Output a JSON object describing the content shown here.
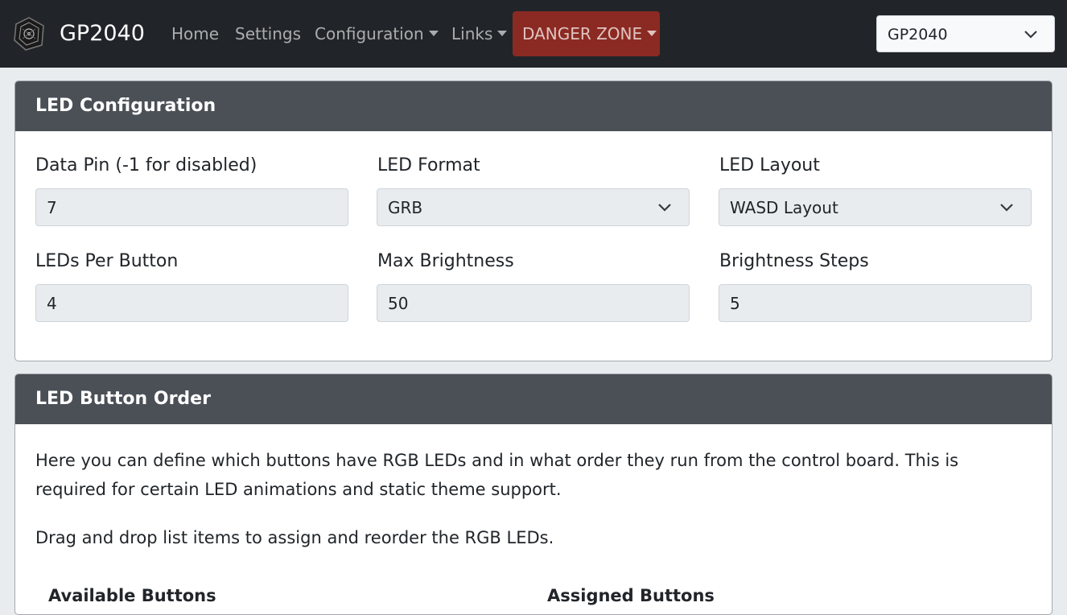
{
  "navbar": {
    "brand": "GP2040",
    "links": [
      {
        "label": "Home"
      },
      {
        "label": "Settings"
      },
      {
        "label": "Configuration"
      },
      {
        "label": "Links"
      }
    ],
    "danger_label": "DANGER ZONE",
    "board_select_value": "GP2040"
  },
  "led_config": {
    "title": "LED Configuration",
    "fields": [
      {
        "label": "Data Pin (-1 for disabled)",
        "value": "7"
      },
      {
        "label": "LED Format",
        "value": "GRB"
      },
      {
        "label": "LED Layout",
        "value": "WASD Layout"
      },
      {
        "label": "LEDs Per Button",
        "value": "4"
      },
      {
        "label": "Max Brightness",
        "value": "50"
      },
      {
        "label": "Brightness Steps",
        "value": "5"
      }
    ]
  },
  "led_order": {
    "title": "LED Button Order",
    "description_line1": "Here you can define which buttons have RGB LEDs and in what order they run from the control board. This is",
    "description_line2": "required for certain LED animations and static theme support.",
    "instructions": "Drag and drop list items to assign and reorder the RGB LEDs.",
    "available_heading": "Available Buttons",
    "assigned_heading": "Assigned Buttons"
  },
  "colors": {
    "navbar_bg": "#212529",
    "danger_bg": "#8b2a22",
    "card_header_bg": "#4a5056",
    "page_bg": "#e9ecef"
  }
}
